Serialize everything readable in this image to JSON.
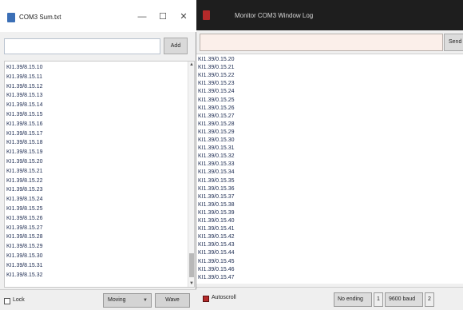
{
  "left_window": {
    "title": "COM3 Sum.txt",
    "controls": {
      "minimize": "—",
      "maximize": "☐",
      "close": "✕"
    },
    "search": {
      "value": "",
      "placeholder": ""
    },
    "send_label": "Add",
    "items": [
      "KI1.39/8.15.10",
      "KI1.39/8.15.11",
      "KI1.39/8.15.12",
      "KI1.39/8.15.13",
      "KI1.39/8.15.14",
      "KI1.39/8.15.15",
      "KI1.39/8.15.16",
      "KI1.39/8.15.17",
      "KI1.39/8.15.18",
      "KI1.39/8.15.19",
      "KI1.39/8.15.20",
      "KI1.39/8.15.21",
      "KI1.39/8.15.22",
      "KI1.39/8.15.23",
      "KI1.39/8.15.24",
      "KI1.39/8.15.25",
      "KI1.39/8.15.26",
      "KI1.39/8.15.27",
      "KI1.39/8.15.28",
      "KI1.39/8.15.29",
      "KI1.39/8.15.30",
      "KI1.39/8.15.31",
      "KI1.39/8.15.32"
    ],
    "status": {
      "checkbox_label": "Lock",
      "select_value": "Moving",
      "button_label": "Wave"
    }
  },
  "right_window": {
    "title": "Monitor COM3 Window Log",
    "search": {
      "value": "",
      "placeholder": ""
    },
    "send_label": "Send",
    "items": [
      "KI1.39/0.15.20",
      "KI1.39/0.15.21",
      "KI1.39/0.15.22",
      "KI1.39/0.15.23",
      "KI1.39/0.15.24",
      "KI1.39/0.15.25",
      "KI1.39/0.15.26",
      "KI1.39/0.15.27",
      "KI1.39/0.15.28",
      "KI1.39/0.15.29",
      "KI1.39/0.15.30",
      "KI1.39/0.15.31",
      "KI1.39/0.15.32",
      "KI1.39/0.15.33",
      "KI1.39/0.15.34",
      "KI1.39/0.15.35",
      "KI1.39/0.15.36",
      "KI1.39/0.15.37",
      "KI1.39/0.15.38",
      "KI1.39/0.15.39",
      "KI1.39/0.15.40",
      "KI1.39/0.15.41",
      "KI1.39/0.15.42",
      "KI1.39/0.15.43",
      "KI1.39/0.15.44",
      "KI1.39/0.15.45",
      "KI1.39/0.15.46",
      "KI1.39/0.15.47"
    ],
    "status": {
      "checkbox_label": "Autoscroll",
      "select1_value": "No ending",
      "stepper1": "1",
      "select2_value": "9600 baud",
      "stepper2": "2"
    }
  },
  "colors": {
    "right_titlebar": "#1e1e1e",
    "right_input_bg": "#fbefea",
    "autoscroll_check": "#b52a2a",
    "left_app_icon": "#3b6fb6"
  }
}
